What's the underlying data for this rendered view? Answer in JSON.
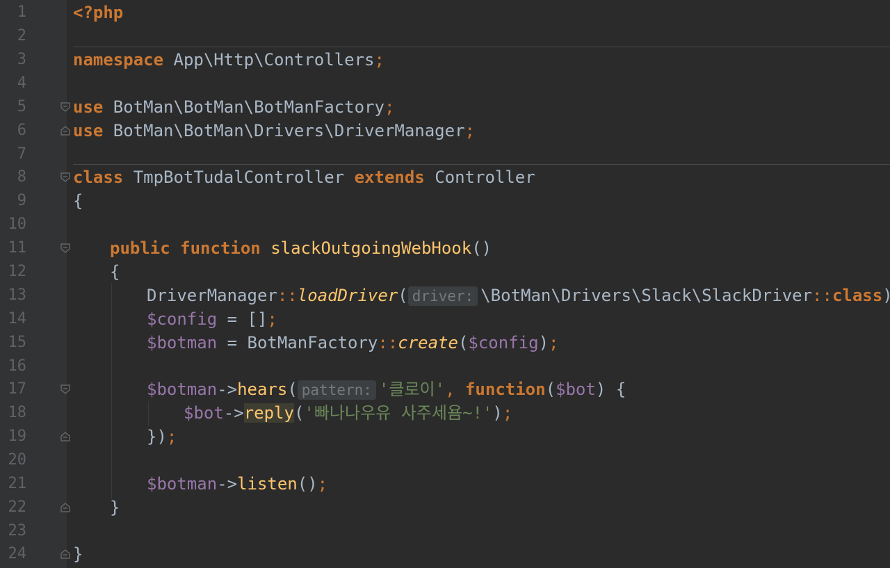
{
  "lines": [
    {
      "n": "1",
      "t": "<?php"
    },
    {
      "n": "2",
      "t": ""
    },
    {
      "n": "3",
      "kw": "namespace",
      "rest": " App\\Http\\Controllers",
      "semi": ";"
    },
    {
      "n": "4",
      "t": ""
    },
    {
      "n": "5",
      "kw": "use",
      "rest": " BotMan\\BotMan\\BotManFactory",
      "semi": ";"
    },
    {
      "n": "6",
      "kw": "use",
      "rest": " BotMan\\BotMan\\Drivers\\DriverManager",
      "semi": ";"
    },
    {
      "n": "7",
      "t": ""
    },
    {
      "n": "8",
      "kw": "class",
      "name": " TmpBotTudalController ",
      "kw2": "extends",
      "parent": " Controller"
    },
    {
      "n": "9",
      "t": "{"
    },
    {
      "n": "10",
      "t": ""
    },
    {
      "n": "11",
      "kw": "public",
      "kw2": " function",
      "fn": " slackOutgoingWebHook",
      "rest": "()"
    },
    {
      "n": "12",
      "t": "{"
    },
    {
      "n": "13",
      "cls": "DriverManager",
      "sep": "::",
      "fn": "loadDriver",
      "open": "(",
      "hint": "driver:",
      "arg": "\\BotMan\\Drivers\\Slack\\SlackDriver",
      "sep2": "::",
      "kw": "class",
      "close": ")",
      "semi": ";"
    },
    {
      "n": "14",
      "var": "$config",
      "rest": " = []",
      "semi": ";"
    },
    {
      "n": "15",
      "var": "$botman",
      "rest": " = BotManFactory",
      "sep": "::",
      "fn": "create",
      "open": "(",
      "var2": "$config",
      "close": ")",
      "semi": ";"
    },
    {
      "n": "16",
      "t": ""
    },
    {
      "n": "17",
      "var": "$botman",
      "arrow": "->",
      "fn": "hears",
      "open": "(",
      "hint": "pattern:",
      "str": "'클로이'",
      "comma": ",",
      "kw": " function",
      "open2": "(",
      "var2": "$bot",
      "close": ") {"
    },
    {
      "n": "18",
      "var": "$bot",
      "arrow": "->",
      "fn": "reply",
      "open": "(",
      "str": "'빠나나우유 사주세욤~!'",
      "close": ")",
      "semi": ";"
    },
    {
      "n": "19",
      "t": "})",
      "semi": ";"
    },
    {
      "n": "20",
      "t": ""
    },
    {
      "n": "21",
      "var": "$botman",
      "arrow": "->",
      "fn": "listen",
      "rest": "()",
      "semi": ";"
    },
    {
      "n": "22",
      "t": "}"
    },
    {
      "n": "23",
      "t": ""
    },
    {
      "n": "24",
      "t": "}"
    }
  ],
  "colors": {
    "background": "#2b2b2b",
    "gutter": "#313335",
    "keyword": "#cc7832",
    "variable": "#9876aa",
    "function": "#ffc66d",
    "string": "#6a8759",
    "text": "#a9b7c6",
    "line_number": "#606366"
  },
  "icons": [
    "fold-open-icon",
    "fold-close-icon"
  ]
}
